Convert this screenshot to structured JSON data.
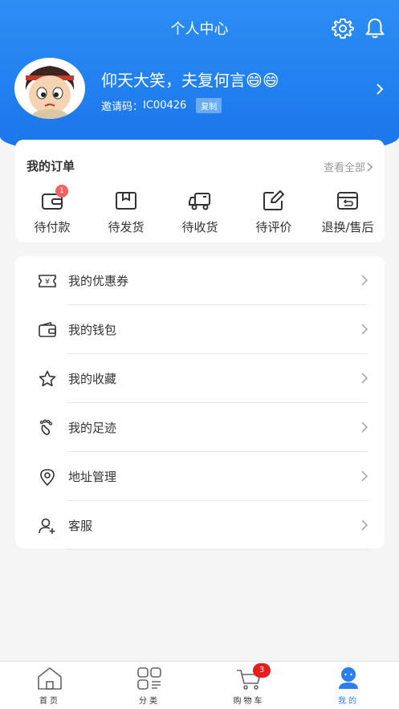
{
  "header": {
    "title": "个人中心",
    "settings_icon": "gear-icon",
    "notification_icon": "bell-icon"
  },
  "profile": {
    "username": "仰天大笑，夫复何言😄😄",
    "invite_label": "邀请码：",
    "invite_code": "IC00426",
    "copy_label": "复制"
  },
  "orders": {
    "title": "我的订单",
    "view_all": "查看全部",
    "items": [
      {
        "label": "待付款",
        "icon": "wallet-icon",
        "badge": "1"
      },
      {
        "label": "待发货",
        "icon": "package-icon"
      },
      {
        "label": "待收货",
        "icon": "truck-icon"
      },
      {
        "label": "待评价",
        "icon": "edit-icon"
      },
      {
        "label": "退换/售后",
        "icon": "return-icon"
      }
    ]
  },
  "menu": {
    "items": [
      {
        "label": "我的优惠券",
        "icon": "coupon-icon"
      },
      {
        "label": "我的钱包",
        "icon": "wallet-icon"
      },
      {
        "label": "我的收藏",
        "icon": "star-icon"
      },
      {
        "label": "我的足迹",
        "icon": "footprint-icon"
      },
      {
        "label": "地址管理",
        "icon": "location-icon"
      },
      {
        "label": "客服",
        "icon": "customer-service-icon"
      }
    ]
  },
  "tabbar": {
    "items": [
      {
        "label": "首页",
        "icon": "home-icon"
      },
      {
        "label": "分类",
        "icon": "category-icon"
      },
      {
        "label": "购物车",
        "icon": "cart-icon",
        "badge": "3"
      },
      {
        "label": "我的",
        "icon": "profile-icon",
        "active": true
      }
    ]
  },
  "colors": {
    "primary": "#1a74ea",
    "badge": "#e81c1c",
    "active_tab": "#2a7ff0"
  }
}
